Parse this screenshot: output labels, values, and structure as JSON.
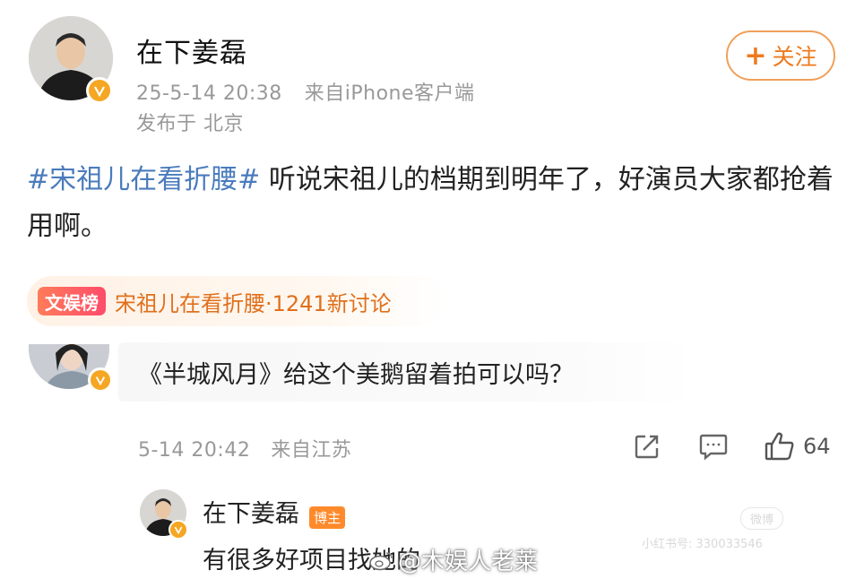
{
  "post": {
    "author_name": "在下姜磊",
    "timestamp": "25-5-14 20:38",
    "source": "来自iPhone客户端",
    "location": "发布于 北京",
    "follow_label": "关注",
    "hashtag": "#宋祖儿在看折腰#",
    "body": " 听说宋祖儿的档期到明年了，好演员大家都抢着用啊。"
  },
  "hot_topic": {
    "tag": "文娱榜",
    "text": "宋祖儿在看折腰·1241新讨论"
  },
  "comment": {
    "text": "《半城风月》给这个美鹅留着拍可以吗？",
    "timestamp": "5-14 20:42",
    "source": "来自江苏",
    "like_count": "64"
  },
  "reply": {
    "author_name": "在下姜磊",
    "author_tag": "博主",
    "text": "有很多好项目找她的"
  },
  "watermark": {
    "text": "@木娱人老莱",
    "faint_logo": "微博",
    "faint_id": "小红书号: 330033546"
  },
  "colors": {
    "hashtag": "#4a7bbd",
    "accent_orange": "#ee7a1e",
    "verified_badge": "#f5a623"
  },
  "icons": [
    "plus-icon",
    "verified-badge-icon",
    "share-icon",
    "comment-icon",
    "like-icon"
  ]
}
